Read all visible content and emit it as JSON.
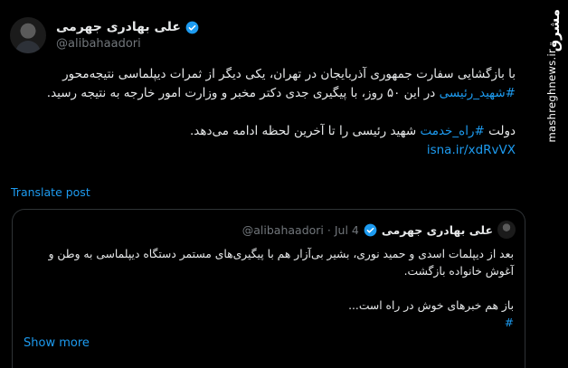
{
  "tweet": {
    "author_name": "علی بهادری جهرمی",
    "handle": "@alibahaadori",
    "line1": "با بازگشایی سفارت جمهوری آذربایجان در تهران، یکی دیگر از ثمرات دیپلماسی نتیجه‌محور",
    "hashtag1": "#شهید_رئیسی",
    "line2_rest": " در این ۵۰ روز، با پیگیری جدی دکتر مخبر و وزارت امور خارجه به نتیجه رسید.",
    "line3_start": "دولت ",
    "hashtag2": "#راه_خدمت",
    "line3_rest": " شهید رئیسی را تا آخرین لحظه ادامه می‌دهد.",
    "link": "isna.ir/xdRvVX",
    "translate_label": "Translate post"
  },
  "quote": {
    "author_name": "علی بهادری جهرمی",
    "handle": "@alibahaadori",
    "date": "Jul 4",
    "separator": "·",
    "para1": "بعد از دیپلمات اسدی و حمید نوری، بشیر بی‌آزار هم با پیگیری‌های مستمر دستگاه دیپلماسی به وطن و آغوش خانواده بازگشت.",
    "para2": "باز هم خبرهای خوش در راه است...",
    "hashtag": "#",
    "show_more": "Show more"
  },
  "watermark": {
    "logo": "مشرق",
    "url": "mashreghnews.ir"
  },
  "colors": {
    "background": "#000000",
    "text": "#e7e9ea",
    "secondary": "#71767b",
    "accent": "#1d9bf0",
    "border": "#2f3336"
  }
}
